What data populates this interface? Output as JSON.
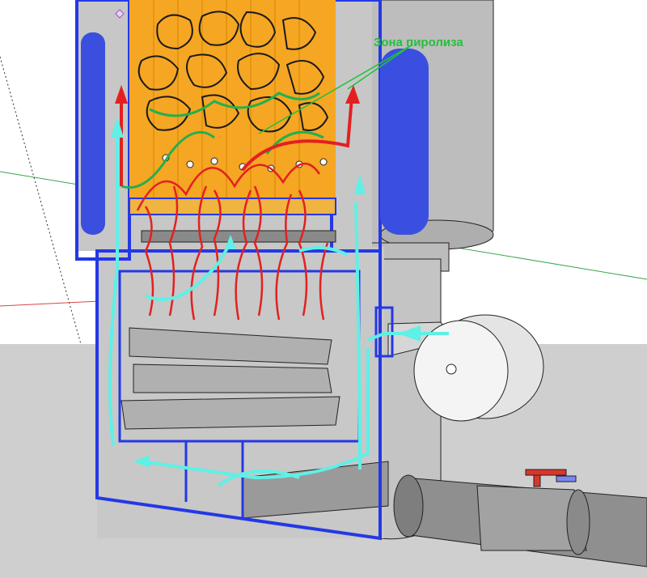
{
  "annotation": {
    "label": "Зона пиролиза"
  },
  "colors": {
    "steel_frame": "#2438e6",
    "concrete": "#c4c4c4",
    "fuel_fill": "#f5a623",
    "flame": "#e32020",
    "air_flow": "#5ff0e6",
    "pyrolysis_flow": "#22b14c",
    "valve": "#d9362b"
  }
}
